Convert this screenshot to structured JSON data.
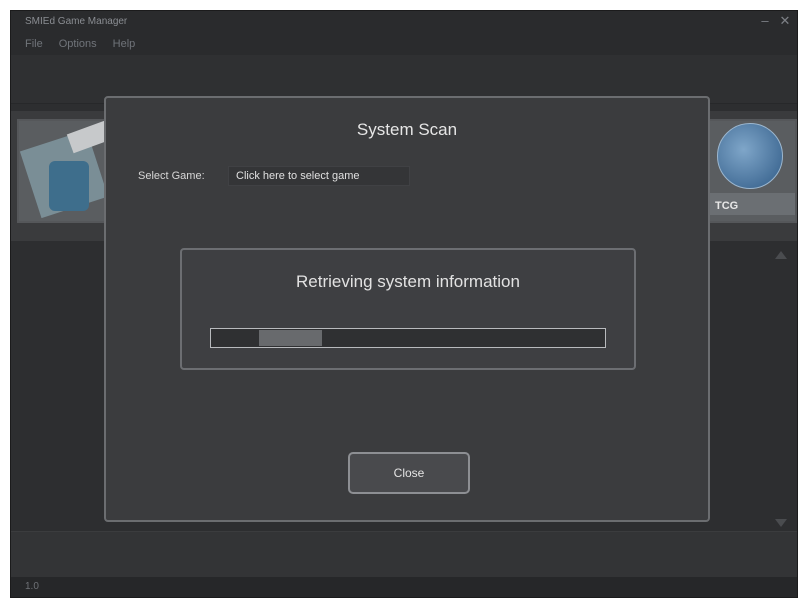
{
  "window": {
    "title": "SMIEd Game Manager",
    "controls": [
      "–",
      "✕"
    ]
  },
  "menu": [
    "File",
    "Options",
    "Help"
  ],
  "carousel": {
    "left_thumb_icon": "game-thumbnail-icon",
    "right_thumb_icon": "globe-thumbnail-icon",
    "right_thumb_label": "TCG"
  },
  "status": {
    "version": "1.0"
  },
  "dialog": {
    "title": "System Scan",
    "select_label": "Select Game:",
    "select_value": "Click here to select game",
    "progress_text": "Retrieving system information",
    "progress_fraction": 0.16,
    "close_label": "Close"
  },
  "colors": {
    "background": "#2d2e30",
    "dialog": "#3b3c3e",
    "border": "#6b6d70"
  }
}
